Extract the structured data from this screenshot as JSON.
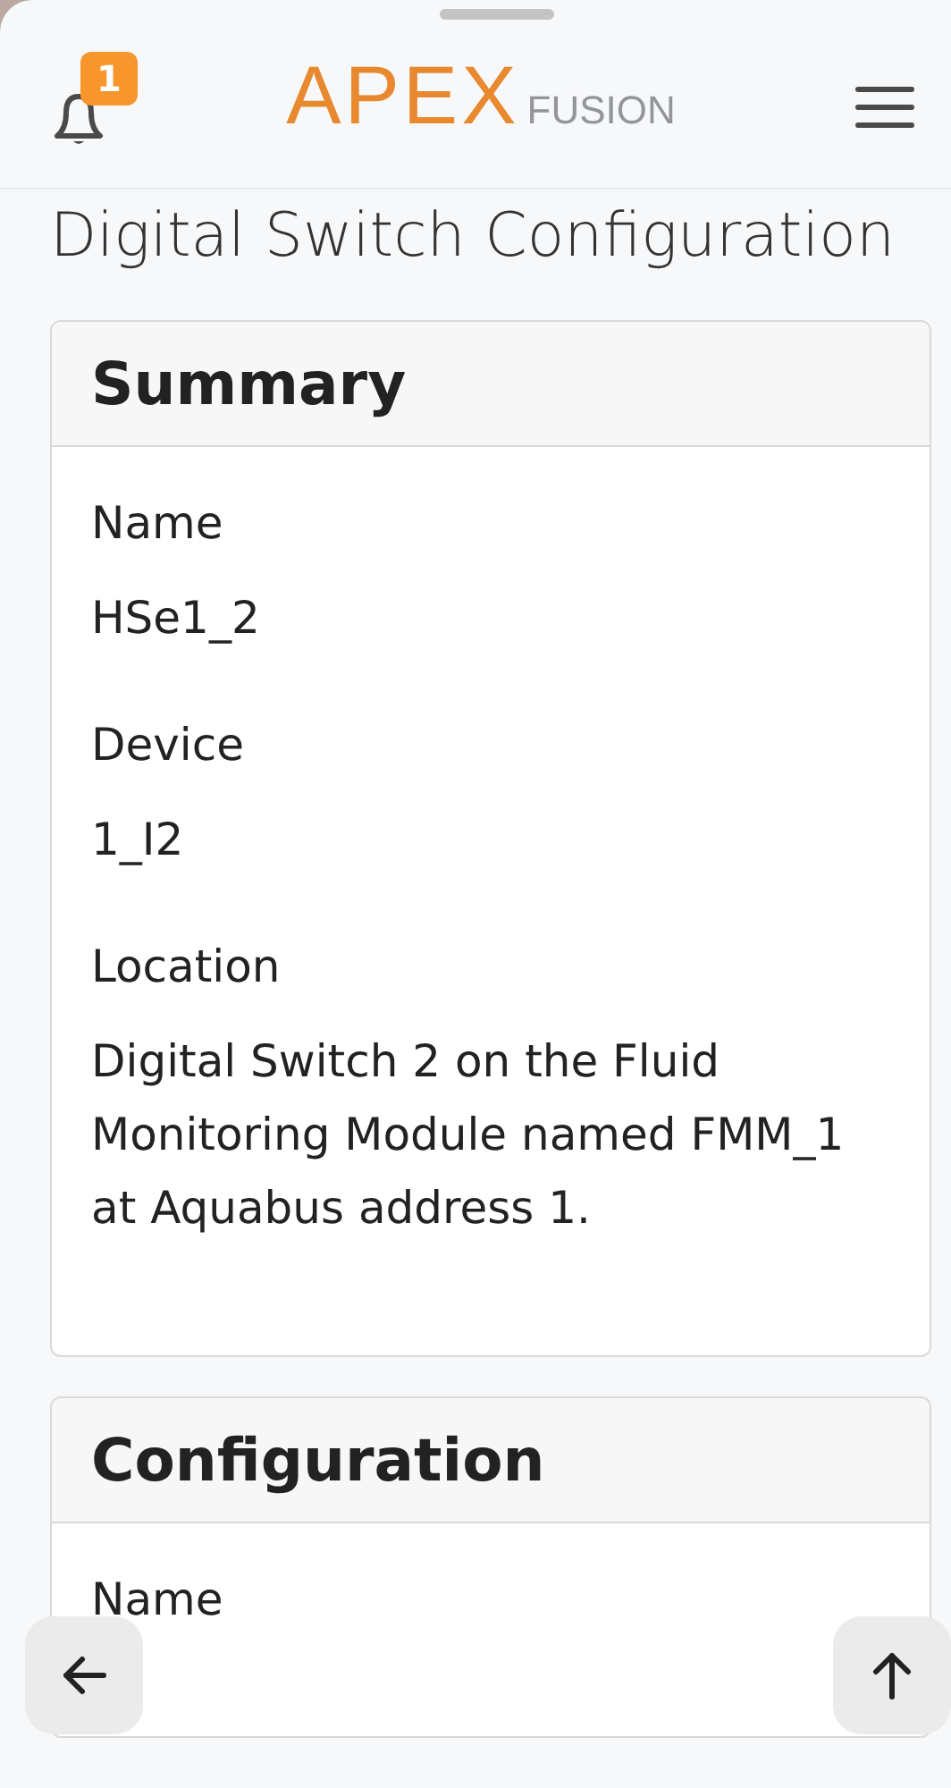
{
  "header": {
    "notification_count": "1",
    "logo_main": "APEX",
    "logo_sub": "FUSION"
  },
  "page_title": "Digital Switch Configuration",
  "cards": [
    {
      "title": "Summary",
      "fields": [
        {
          "label": "Name",
          "value": "HSe1_2"
        },
        {
          "label": "Device",
          "value": "1_I2"
        },
        {
          "label": "Location",
          "value": "Digital Switch 2 on the Fluid Monitoring Module named FMM_1 at Aquabus address 1."
        }
      ]
    },
    {
      "title": "Configuration",
      "fields": [
        {
          "label": "Name"
        }
      ]
    }
  ]
}
